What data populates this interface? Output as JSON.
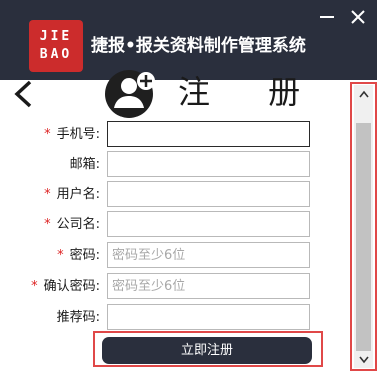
{
  "titlebar": {
    "logo_line1": "JIE",
    "logo_line2": "BAO",
    "app_title": "捷报•报关资料制作管理系统",
    "minimize_icon": "minimize-icon",
    "close_icon": "close-icon",
    "background": "#2a2f3d",
    "logo_color": "#cc2c2c"
  },
  "header": {
    "back_icon": "chevron-left-icon",
    "avatar_icon": "user-add-icon",
    "title": "注 册"
  },
  "form": {
    "fields": [
      {
        "label": "手机号:",
        "required": true,
        "value": "",
        "placeholder": ""
      },
      {
        "label": "邮箱:",
        "required": false,
        "value": "",
        "placeholder": ""
      },
      {
        "label": "用户名:",
        "required": true,
        "value": "",
        "placeholder": ""
      },
      {
        "label": "公司名:",
        "required": true,
        "value": "",
        "placeholder": ""
      },
      {
        "label": "密码:",
        "required": true,
        "value": "",
        "placeholder": "密码至少6位"
      },
      {
        "label": "确认密码:",
        "required": true,
        "value": "",
        "placeholder": "密码至少6位"
      },
      {
        "label": "推荐码:",
        "required": false,
        "value": "",
        "placeholder": ""
      }
    ],
    "required_mark": "*",
    "required_color": "#dd2222"
  },
  "actions": {
    "register_label": "立即注册",
    "highlight_color": "#e04848"
  },
  "scrollbar": {
    "up_icon": "arrow-up-icon",
    "down_icon": "arrow-down-icon"
  }
}
